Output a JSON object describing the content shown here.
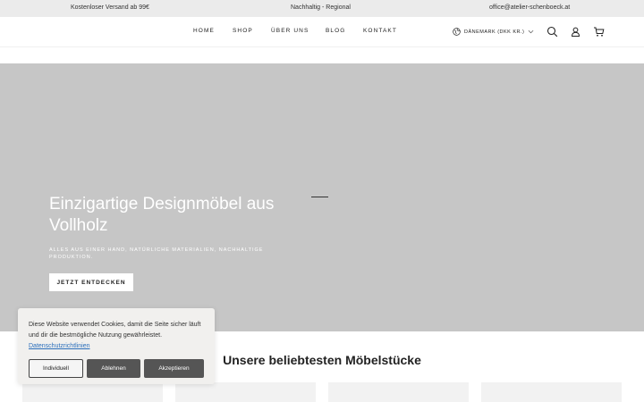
{
  "announcement": {
    "shipping": "Kostenloser Versand ab 99€",
    "tagline": "Nachhaltig - Regional",
    "email": "office@atelier-schenboeck.at"
  },
  "nav": {
    "home": "HOME",
    "shop": "SHOP",
    "about": "ÜBER UNS",
    "blog": "BLOG",
    "contact": "KONTAKT"
  },
  "country_selector": {
    "label": "DÄNEMARK (DKK KR.)",
    "icon": "globe-icon"
  },
  "header_icons": [
    "search-icon",
    "account-icon",
    "cart-icon"
  ],
  "hero": {
    "title": "Einzigartige Designmöbel aus Vollholz",
    "subtitle": "ALLES AUS EINER HAND, NATÜRLICHE MATERIALIEN, NACHHALTIGE PRODUKTION.",
    "cta": "JETZT ENTDECKEN"
  },
  "products": {
    "title": "Unsere beliebtesten Möbelstücke"
  },
  "cookie_banner": {
    "text": "Diese Website verwendet Cookies, damit die Seite sicher läuft und dir die bestmögliche Nutzung gewährleistet.",
    "link": "Datenschutzrichtlinien",
    "individual": "Individuell",
    "decline": "Ablehnen",
    "accept": "Akzeptieren"
  },
  "colors": {
    "announcement_bg": "#ebebeb",
    "hero_bg": "#c6c6c6",
    "button_dark": "#555555",
    "link": "#2a6ebb"
  }
}
